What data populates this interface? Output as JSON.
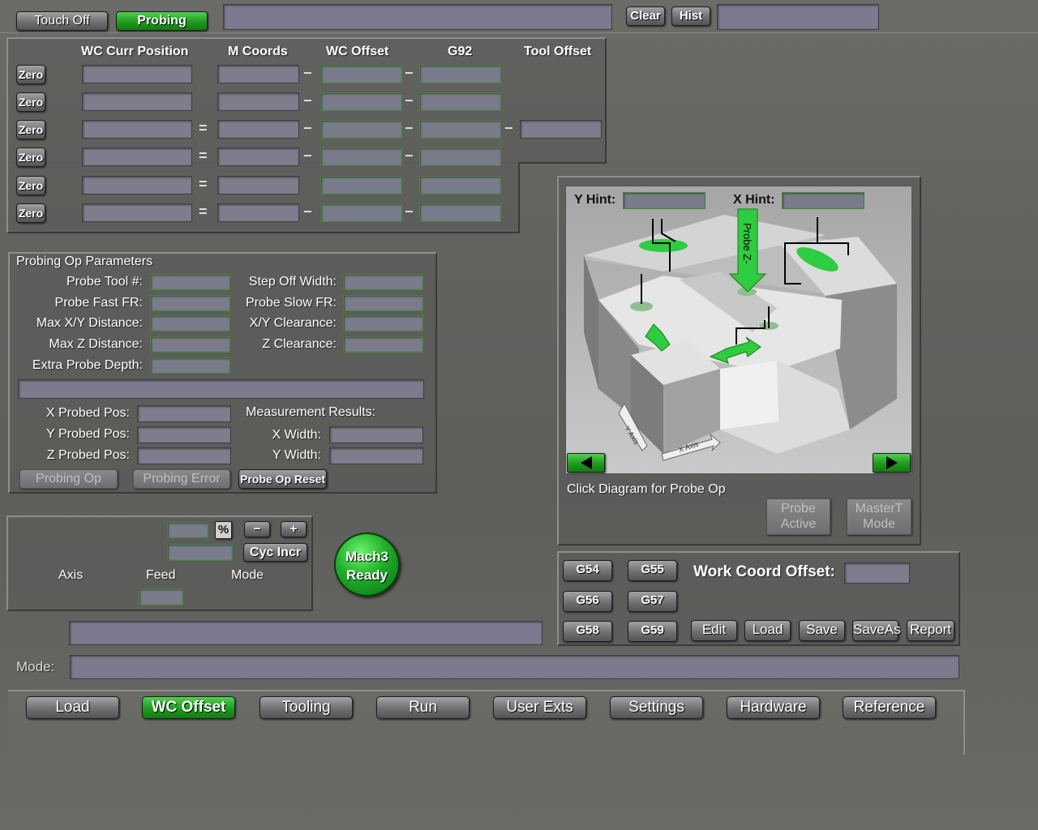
{
  "top": {
    "touch_off": "Touch Off",
    "probing": "Probing",
    "clear": "Clear",
    "hist": "Hist"
  },
  "coords": {
    "headers": [
      "WC Curr Position",
      "M Coords",
      "WC Offset",
      "G92",
      "Tool Offset"
    ],
    "zero_label": "Zero",
    "rows": [
      {
        "op1": "",
        "op2": "−",
        "op3": "−",
        "op4": ""
      },
      {
        "op1": "",
        "op2": "−",
        "op3": "−",
        "op4": ""
      },
      {
        "op1": "=",
        "op2": "−",
        "op3": "−",
        "op4": "−"
      },
      {
        "op1": "=",
        "op2": "−",
        "op3": "−",
        "op4": ""
      },
      {
        "op1": "=",
        "op2": "",
        "op3": "",
        "op4": ""
      },
      {
        "op1": "=",
        "op2": "−",
        "op3": "−",
        "op4": ""
      }
    ]
  },
  "probing": {
    "title": "Probing Op Parameters",
    "left_labels": [
      "Probe Tool #:",
      "Probe Fast FR:",
      "Max X/Y Distance:",
      "Max Z Distance:",
      "Extra Probe Depth:"
    ],
    "right_labels": [
      "Step Off Width:",
      "Probe Slow FR:",
      "X/Y Clearance:",
      "Z Clearance:"
    ],
    "probed_labels": [
      "X Probed Pos:",
      "Y Probed Pos:",
      "Z Probed Pos:"
    ],
    "measurement_title": "Measurement Results:",
    "measure_labels": [
      "X Width:",
      "Y Width:"
    ],
    "btn_op": "Probing Op",
    "btn_error": "Probing Error",
    "btn_reset": "Probe Op Reset"
  },
  "diagram": {
    "y_hint": "Y Hint:",
    "x_hint": "X Hint:",
    "probe_z": "Probe Z-",
    "y_axis": "Y Axis",
    "x_axis": "X Axis",
    "caption": "Click Diagram for Probe Op",
    "probe_active": [
      "Probe",
      "Active"
    ],
    "mastert_mode": [
      "MasterT",
      "Mode"
    ]
  },
  "feed": {
    "percent": "%",
    "minus": "−",
    "plus": "+",
    "cyc_incr": "Cyc Incr",
    "axis": "Axis",
    "feed": "Feed",
    "mode": "Mode"
  },
  "status": {
    "line1": "Mach3",
    "line2": "Ready"
  },
  "work": {
    "g_buttons": [
      "G54",
      "G55",
      "G56",
      "G57",
      "G58",
      "G59"
    ],
    "offset_label": "Work Coord Offset:",
    "edit": "Edit",
    "load": "Load",
    "save": "Save",
    "saveas": "SaveAs",
    "report": "Report"
  },
  "mode_label": "Mode:",
  "nav": [
    "Load",
    "WC Offset",
    "Tooling",
    "Run",
    "User Exts",
    "Settings",
    "Hardware",
    "Reference"
  ],
  "nav_active": 1,
  "colors": {
    "accent_green": "#1e9b1e",
    "field": "#7d7d8e"
  }
}
